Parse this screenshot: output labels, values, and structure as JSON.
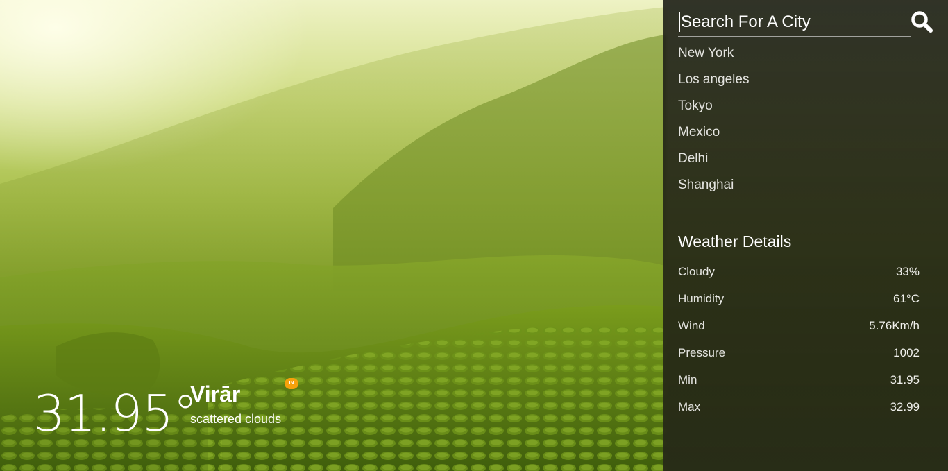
{
  "search": {
    "placeholder": "Search For A City",
    "icon": "search-icon"
  },
  "cities": [
    "New York",
    "Los angeles",
    "Tokyo",
    "Mexico",
    "Delhi",
    "Shanghai"
  ],
  "details": {
    "title": "Weather Details",
    "rows": [
      {
        "label": "Cloudy",
        "value": "33%"
      },
      {
        "label": "Humidity",
        "value": "61°C"
      },
      {
        "label": "Wind",
        "value": "5.76Km/h"
      },
      {
        "label": "Pressure",
        "value": "1002"
      },
      {
        "label": "Min",
        "value": "31.95"
      },
      {
        "label": "Max",
        "value": "32.99"
      }
    ]
  },
  "current": {
    "temperature": "31.95°",
    "city": "Virār",
    "condition": "scattered clouds",
    "country_code": "IN"
  },
  "colors": {
    "sidebar_bg": "#1e2016",
    "text": "#ffffff",
    "badge": "#f5a10c"
  }
}
